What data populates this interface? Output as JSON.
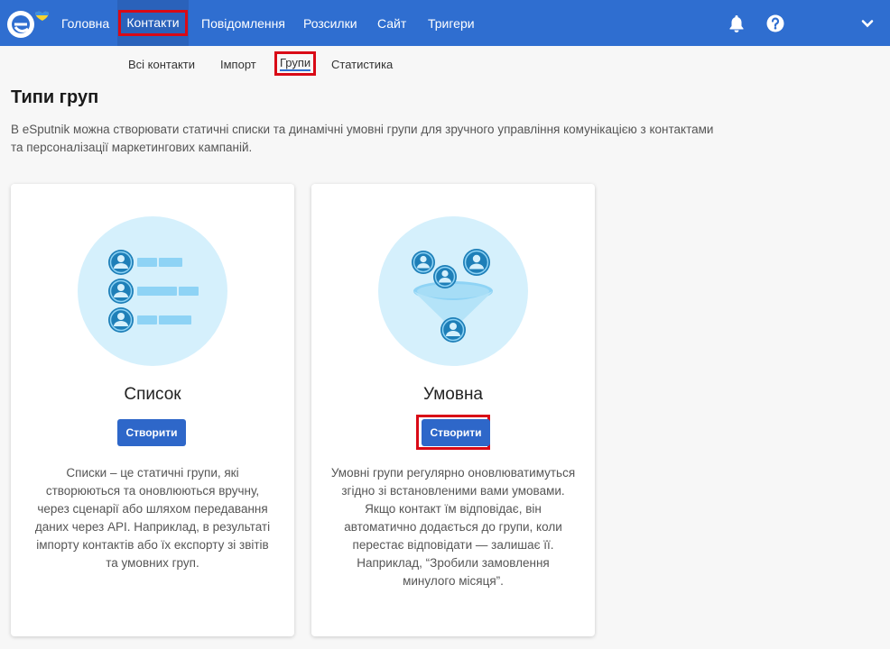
{
  "nav": {
    "items": [
      {
        "label": "Головна"
      },
      {
        "label": "Контакти",
        "active": true
      },
      {
        "label": "Повідомлення"
      },
      {
        "label": "Розсилки"
      },
      {
        "label": "Сайт"
      },
      {
        "label": "Тригери"
      }
    ],
    "icons": [
      "bell-icon",
      "help-icon",
      "chevron-down-icon"
    ]
  },
  "subnav": {
    "items": [
      {
        "label": "Всі контакти"
      },
      {
        "label": "Імпорт"
      },
      {
        "label": "Групи",
        "active": true
      },
      {
        "label": "Статистика"
      }
    ]
  },
  "page": {
    "title": "Типи груп",
    "intro": "В eSputnik можна створювати статичні списки та динамічні умовні групи для зручного управління комунікацією з контактами та персоналізації маркетингових кампаній."
  },
  "cards": [
    {
      "title": "Список",
      "button": "Створити",
      "description": "Списки – це статичні групи, які створюються та оновлюються вручну, через сценарії або шляхом передавання даних через API. Наприклад, в результаті імпорту контактів або їх експорту зі звітів та умовних груп."
    },
    {
      "title": "Умовна",
      "button": "Створити",
      "description": "Умовні групи регулярно оновлюватимуться згідно зі встановленими вами умовами. Якщо контакт їм відповідає, він автоматично додається до групи, коли перестає відповідати — залишає її. Наприклад, “Зробили замовлення минулого місяця”."
    }
  ],
  "colors": {
    "topbar": "#2f6ed0",
    "highlight": "#d90a16",
    "button": "#2e67c9",
    "illustration_bg": "#d5f0fc",
    "illustration_icon": "#1e7fb8"
  }
}
